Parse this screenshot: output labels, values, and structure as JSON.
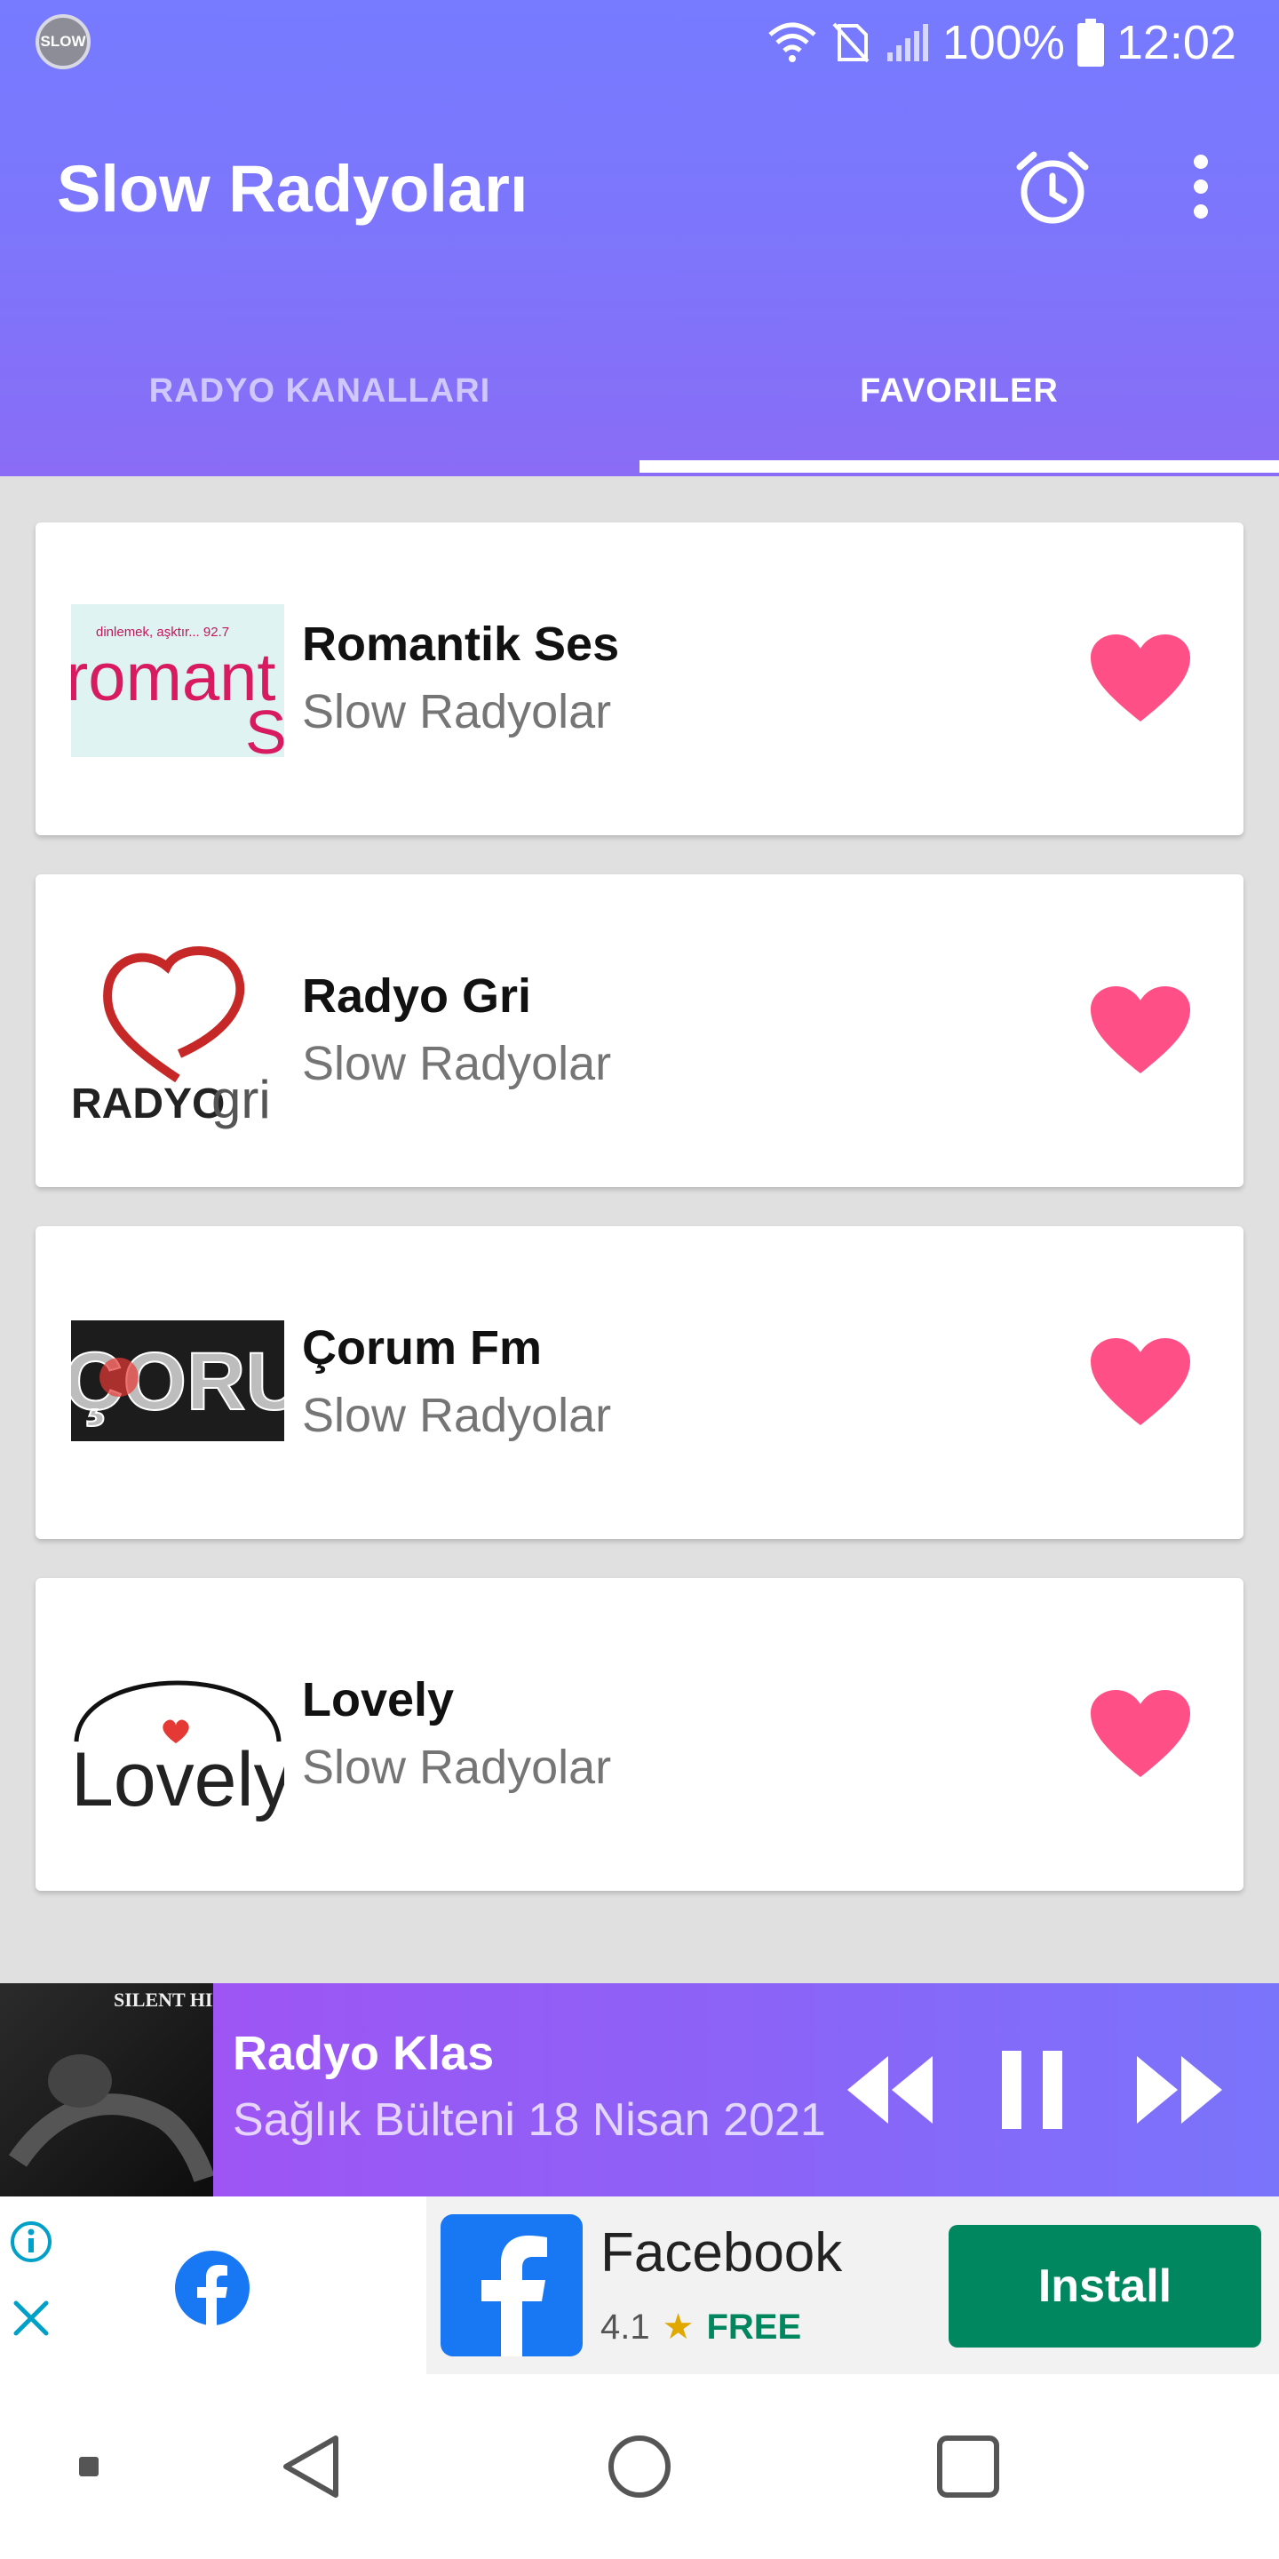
{
  "status_bar": {
    "app_logo_text": "SLOW",
    "battery": "100%",
    "time": "12:02",
    "icons": [
      "wifi-icon",
      "no-sim-icon",
      "signal-icon",
      "battery-icon"
    ]
  },
  "toolbar": {
    "title": "Slow Radyoları",
    "actions": [
      "alarm-icon",
      "more-vert-icon"
    ]
  },
  "tabs": [
    {
      "label": "RADYO KANALLARI",
      "selected": false
    },
    {
      "label": "FAVORILER",
      "selected": true
    }
  ],
  "favorites": [
    {
      "name": "Romantik Ses",
      "category": "Slow Radyolar",
      "favorite": true,
      "logo_text": "romantik ses",
      "logo_caption": "dinlemek, aşktır... 92.7"
    },
    {
      "name": "Radyo Gri",
      "category": "Slow Radyolar",
      "favorite": true,
      "logo_text": "RADYOgri"
    },
    {
      "name": "Çorum Fm",
      "category": "Slow Radyolar",
      "favorite": true,
      "logo_text": "CORUM"
    },
    {
      "name": "Lovely",
      "category": "Slow Radyolar",
      "favorite": true,
      "logo_text": "Lovely"
    }
  ],
  "player": {
    "station": "Radyo Klas",
    "track": "Sağlık Bülteni 18 Nisan 2021",
    "art_text": "SILENT HILL",
    "controls": [
      "rewind-icon",
      "pause-icon",
      "fast-forward-icon"
    ]
  },
  "ad": {
    "app_name": "Facebook",
    "rating": "4.1",
    "price": "FREE",
    "install_label": "Install"
  },
  "colors": {
    "accent": "#7a74fb",
    "heart": "#ff4f87",
    "install": "#01875f"
  }
}
